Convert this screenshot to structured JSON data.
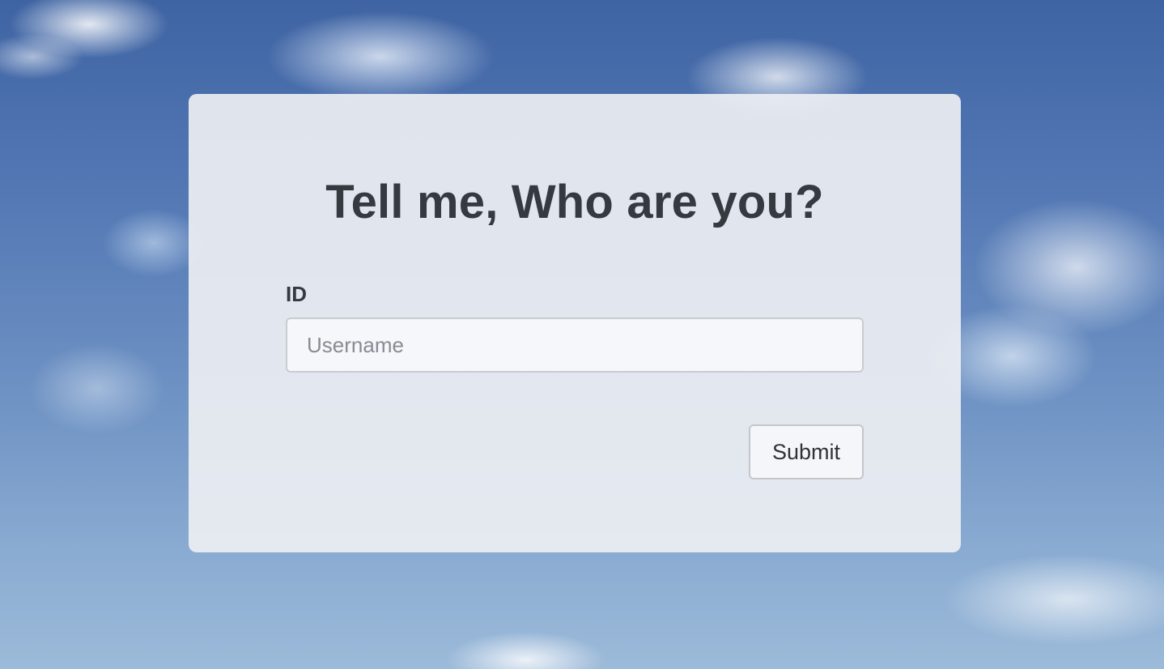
{
  "form": {
    "heading": "Tell me, Who are you?",
    "id_label": "ID",
    "username_placeholder": "Username",
    "username_value": "",
    "submit_label": "Submit"
  },
  "background": {
    "description_color_top": "#3f64a3",
    "description_color_bottom": "#9cbad9"
  }
}
